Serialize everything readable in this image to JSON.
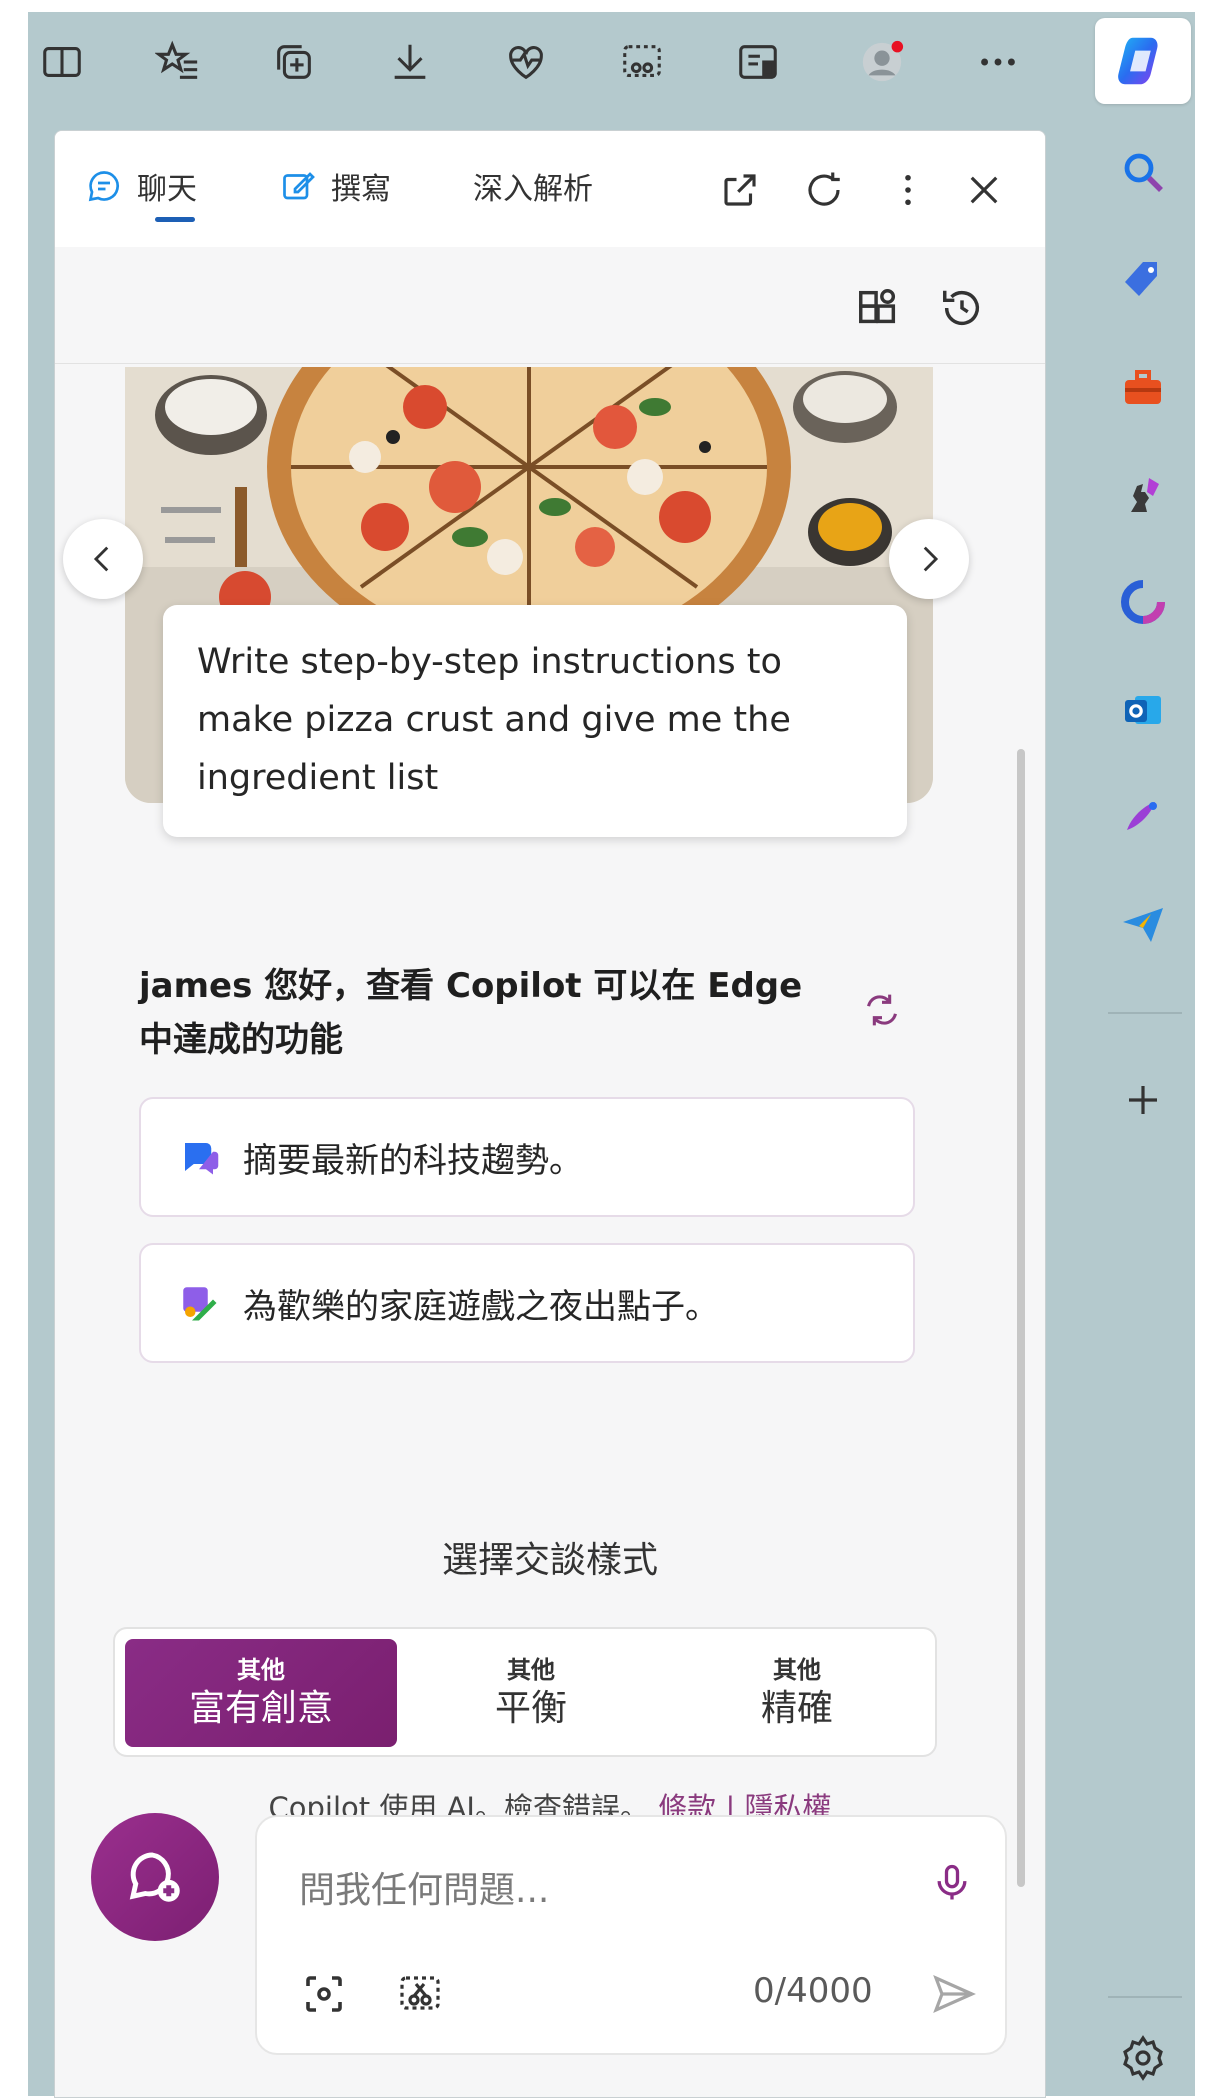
{
  "toolbar": {
    "icons": [
      "split-screen-icon",
      "favorites-icon",
      "collections-icon",
      "downloads-icon",
      "performance-icon",
      "web-capture-icon",
      "reading-view-icon",
      "profile-avatar",
      "more-options-icon",
      "copilot-icon"
    ],
    "profile_notification_color": "#e81123"
  },
  "sidebar": {
    "icons": [
      "search-icon",
      "shopping-icon",
      "tools-icon",
      "games-icon",
      "microsoft365-icon",
      "outlook-icon",
      "designer-icon",
      "drop-icon",
      "add-icon",
      "settings-icon"
    ]
  },
  "pane": {
    "tabs": [
      {
        "label": "聊天",
        "active": true
      },
      {
        "label": "撰寫",
        "active": false
      },
      {
        "label": "深入解析",
        "active": false
      }
    ],
    "header_actions": [
      "open-in-new-tab-icon",
      "refresh-icon",
      "more-icon",
      "close-icon"
    ],
    "sub_actions": [
      "plugins-icon",
      "history-icon"
    ]
  },
  "carousel": {
    "prompt": "Write step-by-step instructions to make pizza crust and give me the ingredient list"
  },
  "greeting": {
    "text": "james 您好，查看 Copilot 可以在 Edge 中達成的功能"
  },
  "suggestions": [
    {
      "label": "摘要最新的科技趨勢。",
      "icon": "chat-bubbles-icon"
    },
    {
      "label": "為歡樂的家庭遊戲之夜出點子。",
      "icon": "paint-brush-icon"
    }
  ],
  "conversation_style": {
    "title": "選擇交談樣式",
    "options": [
      {
        "small": "其他",
        "big": "富有創意",
        "active": true
      },
      {
        "small": "其他",
        "big": "平衡",
        "active": false
      },
      {
        "small": "其他",
        "big": "精確",
        "active": false
      }
    ]
  },
  "disclaimer": {
    "text": "Copilot 使用 AI。檢查錯誤。",
    "terms": "條款",
    "separator": "|",
    "privacy": "隱私權"
  },
  "composer": {
    "placeholder": "問我任何問題...",
    "counter": "0/4000"
  },
  "colors": {
    "accent": "#8a2c86",
    "toolbar_bg": "#b4c9cd",
    "tab_underline": "#1d5fb5"
  }
}
